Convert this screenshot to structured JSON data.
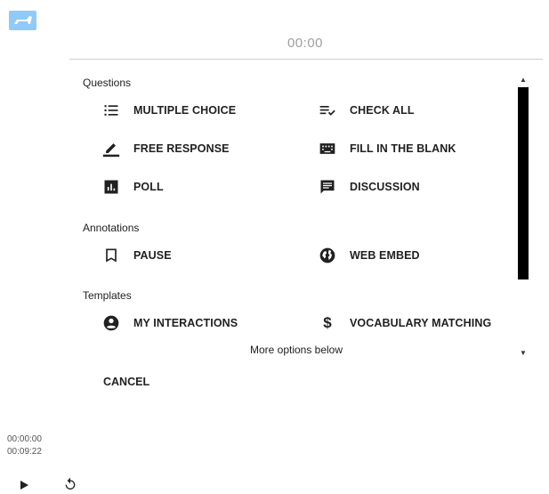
{
  "app": {
    "logo_icon": "dog-logo-icon",
    "accent": "#90caf9"
  },
  "timer": "00:00",
  "sections": {
    "questions": {
      "title": "Questions",
      "items": [
        {
          "label": "MULTIPLE CHOICE",
          "icon": "list-icon"
        },
        {
          "label": "CHECK ALL",
          "icon": "checklist-icon"
        },
        {
          "label": "FREE RESPONSE",
          "icon": "pencil-icon"
        },
        {
          "label": "FILL IN THE BLANK",
          "icon": "keyboard-icon"
        },
        {
          "label": "POLL",
          "icon": "poll-chart-icon"
        },
        {
          "label": "DISCUSSION",
          "icon": "chat-icon"
        }
      ]
    },
    "annotations": {
      "title": "Annotations",
      "items": [
        {
          "label": "PAUSE",
          "icon": "bookmark-icon"
        },
        {
          "label": "WEB EMBED",
          "icon": "globe-icon"
        }
      ]
    },
    "templates": {
      "title": "Templates",
      "items": [
        {
          "label": "MY INTERACTIONS",
          "icon": "account-circle-icon"
        },
        {
          "label": "VOCABULARY MATCHING",
          "icon": "dollar-icon"
        }
      ]
    }
  },
  "more_options": "More options below",
  "cancel_label": "CANCEL",
  "player": {
    "current_time": "00:00:00",
    "total_time": "00:09:22",
    "play_icon": "play-icon",
    "replay_icon": "replay-icon"
  }
}
